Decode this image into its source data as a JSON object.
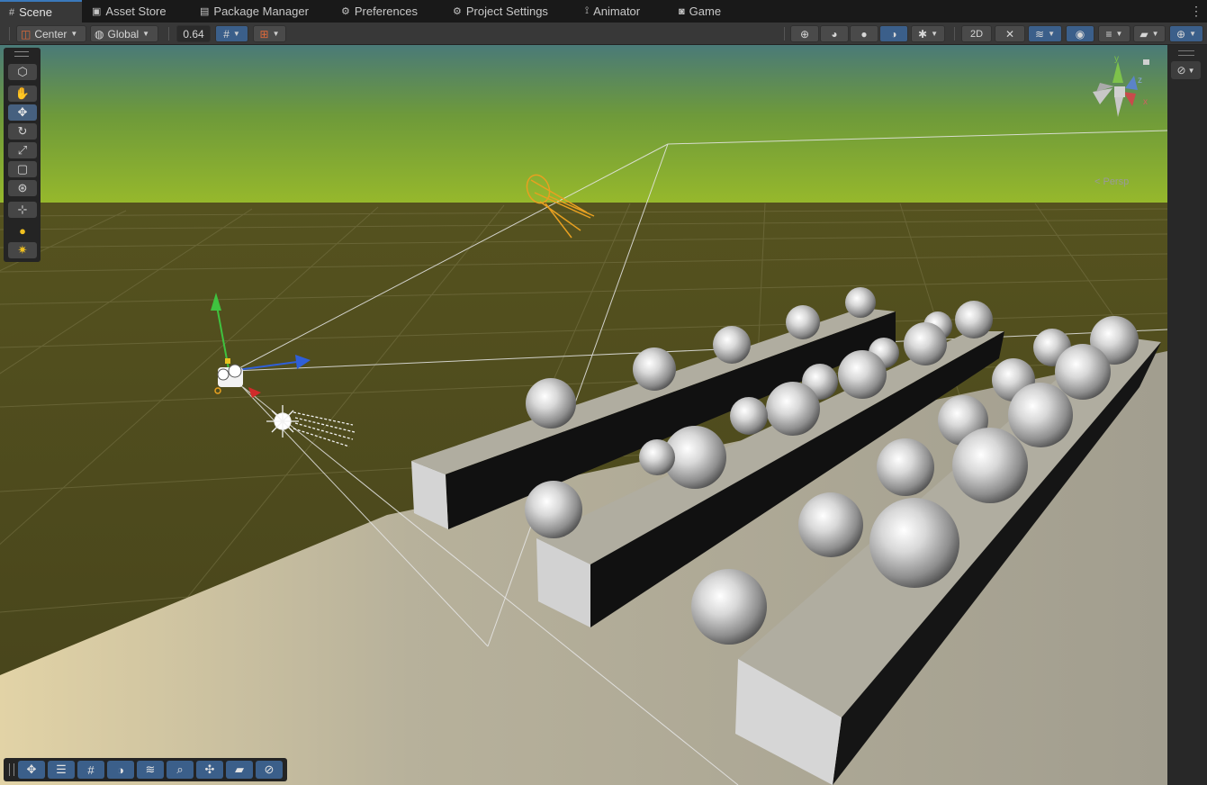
{
  "tabs": [
    {
      "label": "Scene",
      "icon": "grid-icon",
      "active": true
    },
    {
      "label": "Asset Store",
      "icon": "shopping-bag-icon"
    },
    {
      "label": "Package Manager",
      "icon": "package-icon"
    },
    {
      "label": "Preferences",
      "icon": "gear-icon"
    },
    {
      "label": "Project Settings",
      "icon": "gear-icon"
    },
    {
      "label": "Animator",
      "icon": "animator-icon"
    },
    {
      "label": "Game",
      "icon": "gamepad-icon"
    }
  ],
  "toolbar": {
    "pivot_mode": "Center",
    "pivot_rotation": "Global",
    "grid_snap_value": "0.64"
  },
  "scene_view": {
    "projection_label": "< Persp",
    "axes": {
      "y": "y",
      "z": "z",
      "x": "x"
    }
  },
  "colors": {
    "accent": "#3a79bb",
    "selected_tool": "#46607f",
    "sky_top": "#4a7a78",
    "sky_horizon": "#96b82c",
    "ground": "#4c4820",
    "floor": "#a39f8f",
    "light_gizmo": "#e8a020"
  }
}
